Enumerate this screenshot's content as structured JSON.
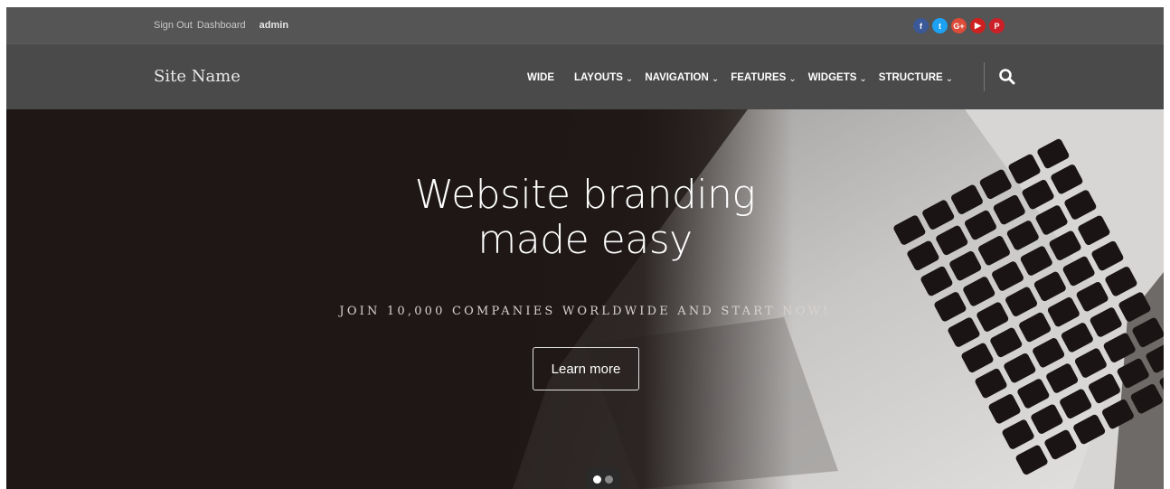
{
  "topbar": {
    "links": [
      "Sign Out",
      "Dashboard"
    ],
    "user": "admin",
    "social": [
      {
        "icon": "facebook-icon",
        "glyph": "f",
        "color": "#3b5998"
      },
      {
        "icon": "twitter-icon",
        "glyph": "t",
        "color": "#1da1f2"
      },
      {
        "icon": "google-plus-icon",
        "glyph": "G+",
        "color": "#dd4b39"
      },
      {
        "icon": "youtube-icon",
        "glyph": "▶",
        "color": "#cd201f"
      },
      {
        "icon": "pinterest-icon",
        "glyph": "P",
        "color": "#cb2027"
      }
    ]
  },
  "nav": {
    "site_name": "Site Name",
    "items": [
      {
        "label": "WIDE",
        "dropdown": false
      },
      {
        "label": "LAYOUTS",
        "dropdown": true
      },
      {
        "label": "NAVIGATION",
        "dropdown": true
      },
      {
        "label": "FEATURES",
        "dropdown": true
      },
      {
        "label": "WIDGETS",
        "dropdown": true
      },
      {
        "label": "STRUCTURE",
        "dropdown": true
      }
    ],
    "search_icon": "search-icon"
  },
  "hero": {
    "title_line1": "Website branding",
    "title_line2": "made easy",
    "subtitle": "JOIN 10,000 COMPANIES WORLDWIDE AND START NOW!",
    "button_label": "Learn more",
    "slides": 2,
    "active_slide": 1
  },
  "colors": {
    "topbar_bg": "#555555",
    "navbar_bg": "#4a4a4a",
    "hero_dark": "#1e1716"
  }
}
